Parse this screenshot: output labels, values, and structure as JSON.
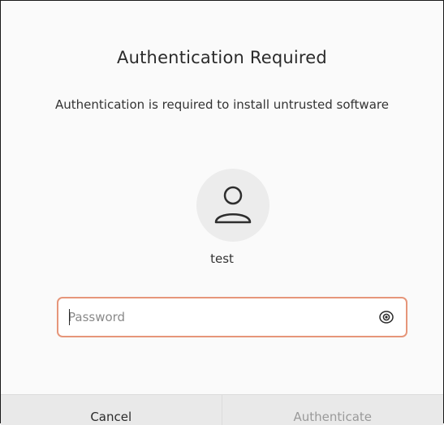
{
  "dialog": {
    "title": "Authentication Required",
    "message": "Authentication is required to install untrusted software",
    "user": {
      "avatar_icon": "user-silhouette-icon",
      "name": "test"
    },
    "password": {
      "placeholder": "Password",
      "value": "",
      "reveal_icon": "eye-icon",
      "focus_color": "#e6967a"
    },
    "buttons": {
      "cancel_label": "Cancel",
      "authenticate_label": "Authenticate",
      "authenticate_enabled": false
    }
  }
}
